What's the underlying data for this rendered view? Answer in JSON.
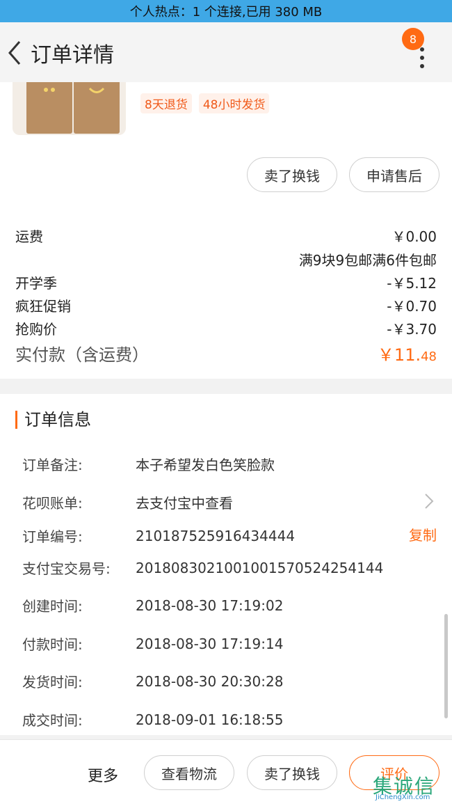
{
  "status_bar": {
    "hotspot_text": "个人热点：1 个连接,已用 380 MB"
  },
  "header": {
    "title": "订单详情",
    "badge_count": "8"
  },
  "product": {
    "tags": [
      "8天退货",
      "48小时发货"
    ]
  },
  "actions": {
    "sell_exchange": "卖了换钱",
    "apply_aftersale": "申请售后"
  },
  "price_rows": [
    {
      "label": "运费",
      "value": "￥0.00"
    },
    {
      "label": "",
      "value": "满9块9包邮满6件包邮"
    },
    {
      "label": "开学季",
      "value": "-￥5.12"
    },
    {
      "label": "疯狂促销",
      "value": "-￥0.70"
    },
    {
      "label": "抢购价",
      "value": "-￥3.70"
    }
  ],
  "total": {
    "label": "实付款（含运费）",
    "currency": "￥",
    "integer": "11.",
    "decimal": "48"
  },
  "order_info": {
    "title": "订单信息",
    "remark": {
      "label": "订单备注:",
      "value": "本子希望发白色笑脸款"
    },
    "huabei": {
      "label": "花呗账单:",
      "value": "去支付宝中查看"
    },
    "order_no": {
      "label": "订单编号:",
      "value": "210187525916434444",
      "copy": "复制"
    },
    "alipay_no": {
      "label": "支付宝交易号:",
      "value": "2018083021001001570524254144"
    },
    "created": {
      "label": "创建时间:",
      "value": "2018-08-30 17:19:02"
    },
    "paid": {
      "label": "付款时间:",
      "value": "2018-08-30 17:19:14"
    },
    "shipped": {
      "label": "发货时间:",
      "value": "2018-08-30 20:30:28"
    },
    "completed": {
      "label": "成交时间:",
      "value": "2018-09-01 16:18:55"
    }
  },
  "footer": {
    "more": "更多",
    "logistics": "查看物流",
    "sell_exchange": "卖了换钱",
    "review": "评价"
  },
  "watermark": {
    "main": "集诚信",
    "sub": "JiChengXin.com"
  },
  "colors": {
    "accent": "#ff6a13",
    "status_bar": "#3fa8e6"
  }
}
